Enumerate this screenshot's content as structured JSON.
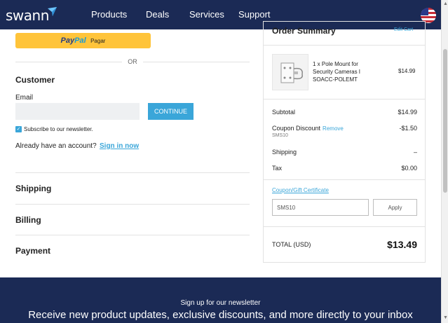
{
  "header": {
    "logo": "swann",
    "nav": [
      {
        "label": "Products"
      },
      {
        "label": "Deals"
      },
      {
        "label": "Services"
      },
      {
        "label": "Support"
      }
    ]
  },
  "payment": {
    "paypal_brand_a": "Pay",
    "paypal_brand_b": "Pal",
    "paypal_text": "Pagar",
    "or_text": "OR"
  },
  "customer": {
    "title": "Customer",
    "email_label": "Email",
    "email_value": "",
    "continue_label": "CONTINUE",
    "subscribe_label": "Subscribe to our newsletter.",
    "subscribe_checked": true,
    "account_prompt": "Already have an account?",
    "signin_label": "Sign in now"
  },
  "steps": {
    "shipping": "Shipping",
    "billing": "Billing",
    "payment": "Payment"
  },
  "summary": {
    "title": "Order Summary",
    "edit_cart": "Edit Cart",
    "product": {
      "name": "1 x Pole Mount for Security Cameras I SOACC-POLEMT",
      "price": "$14.99"
    },
    "subtotal_label": "Subtotal",
    "subtotal_value": "$14.99",
    "coupon_label": "Coupon Discount",
    "coupon_remove": "Remove",
    "coupon_code": "SMS10",
    "coupon_value": "-$1.50",
    "shipping_label": "Shipping",
    "shipping_value": "–",
    "tax_label": "Tax",
    "tax_value": "$0.00",
    "gift_link": "Coupon/Gift Certificate",
    "coupon_input_value": "SMS10",
    "apply_label": "Apply",
    "total_label": "TOTAL (USD)",
    "total_value": "$13.49"
  },
  "footer": {
    "signup": "Sign up for our newsletter",
    "headline": "Receive new product updates, exclusive discounts, and more directly to your inbox"
  },
  "colors": {
    "brand_navy": "#1b2a55",
    "accent_blue": "#3aa6d9",
    "paypal_yellow": "#ffc43a"
  }
}
